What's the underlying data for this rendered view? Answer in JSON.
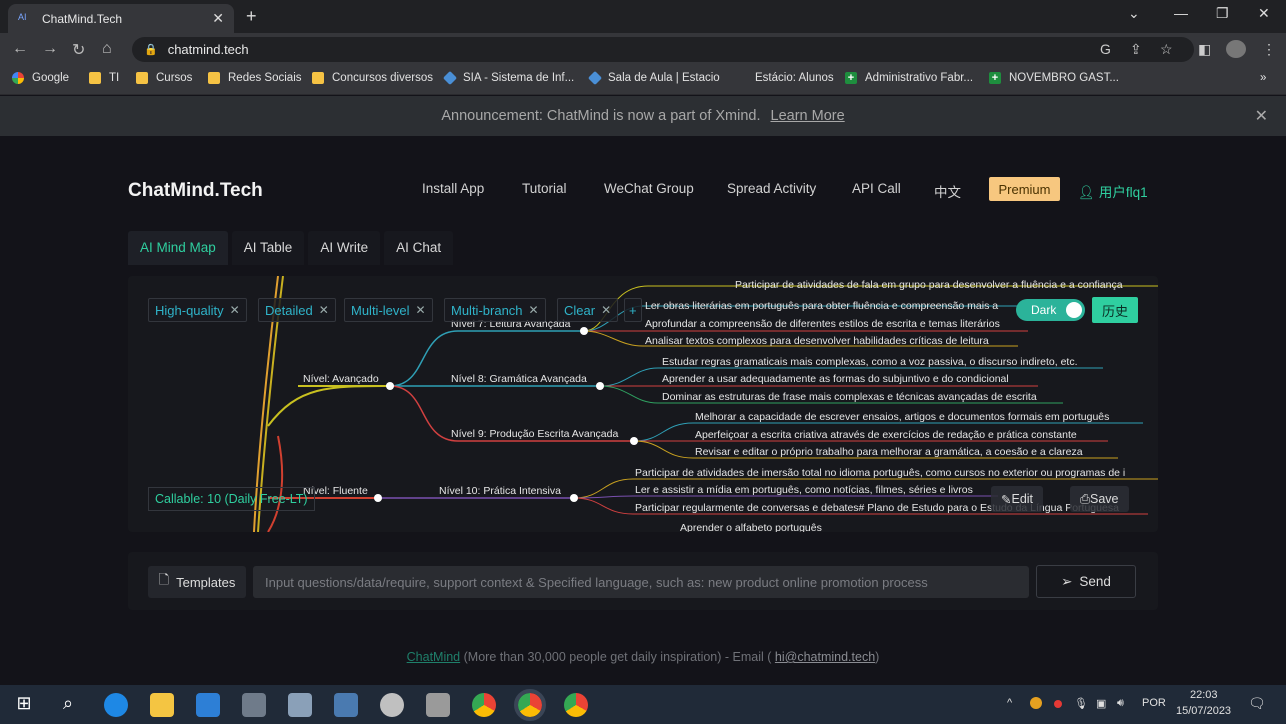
{
  "browser": {
    "tab_title": "ChatMind.Tech",
    "url": "chatmind.tech",
    "bookmarks": [
      "Google",
      "TI",
      "Cursos",
      "Redes Sociais",
      "Concursos diversos",
      "SIA - Sistema de Inf...",
      "Sala de Aula | Estacio",
      "Estácio: Alunos",
      "Administrativo Fabr...",
      "NOVEMBRO GAST..."
    ]
  },
  "announcement": {
    "text": "Announcement: ChatMind is now a part of Xmind.",
    "link": "Learn More"
  },
  "header": {
    "brand": "ChatMind.Tech",
    "nav": [
      "Install App",
      "Tutorial",
      "WeChat Group",
      "Spread Activity",
      "API Call",
      "中文"
    ],
    "premium": "Premium",
    "user": "用户flq1"
  },
  "tabs": [
    "AI Mind Map",
    "AI Table",
    "AI Write",
    "AI Chat"
  ],
  "chips": [
    "High-quality",
    "Detailed",
    "Multi-level",
    "Multi-branch",
    "Clear"
  ],
  "dark_label": "Dark",
  "history_label": "历史",
  "callable": "Callable: 10 (Daily Free-LT)",
  "edit_label": "Edit",
  "save_label": "Save",
  "mindmap": {
    "levels": [
      "Nível: Avançado",
      "Nível: Fluente"
    ],
    "sublevels": [
      "Nível 7: Leitura Avançada",
      "Nível 8: Gramática Avançada",
      "Nível 9: Produção Escrita Avançada",
      "Nível 10: Prática Intensiva"
    ],
    "leaves": [
      "Participar de atividades de fala em grupo para desenvolver a fluência e a confiança",
      "Ler obras literárias em português para obter fluência e compreensão mais a",
      "Aprofundar a compreensão de diferentes estilos de escrita e temas literários",
      "Analisar textos complexos para desenvolver habilidades críticas de leitura",
      "Estudar regras gramaticais mais complexas, como a voz passiva, o discurso indireto, etc.",
      "Aprender a usar adequadamente as formas do subjuntivo e do condicional",
      "Dominar as estruturas de frase mais complexas e técnicas avançadas de escrita",
      "Melhorar a capacidade de escrever ensaios, artigos e documentos formais em português",
      "Aperfeiçoar a escrita criativa através de exercícios de redação e prática constante",
      "Revisar e editar o próprio trabalho para melhorar a gramática, a coesão e a clareza",
      "Participar de atividades de imersão total no idioma português, como cursos no exterior ou programas de i",
      "Ler e assistir a mídia em português, como notícias, filmes, séries e livros",
      "Participar regularmente de conversas e debates# Plano de Estudo para o Estudo da Língua Portuguesa",
      "Aprender o alfabeto português"
    ]
  },
  "input": {
    "templates": "Templates",
    "placeholder": "Input questions/data/require, support context & Specified language, such as: new product online promotion process",
    "send": "Send"
  },
  "footer": {
    "brand": "ChatMind",
    "text": "(More than 30,000 people get daily inspiration) - Email (",
    "email": "hi@chatmind.tech",
    "close": ")"
  },
  "taskbar": {
    "lang": "POR",
    "time": "22:03",
    "date": "15/07/2023"
  }
}
